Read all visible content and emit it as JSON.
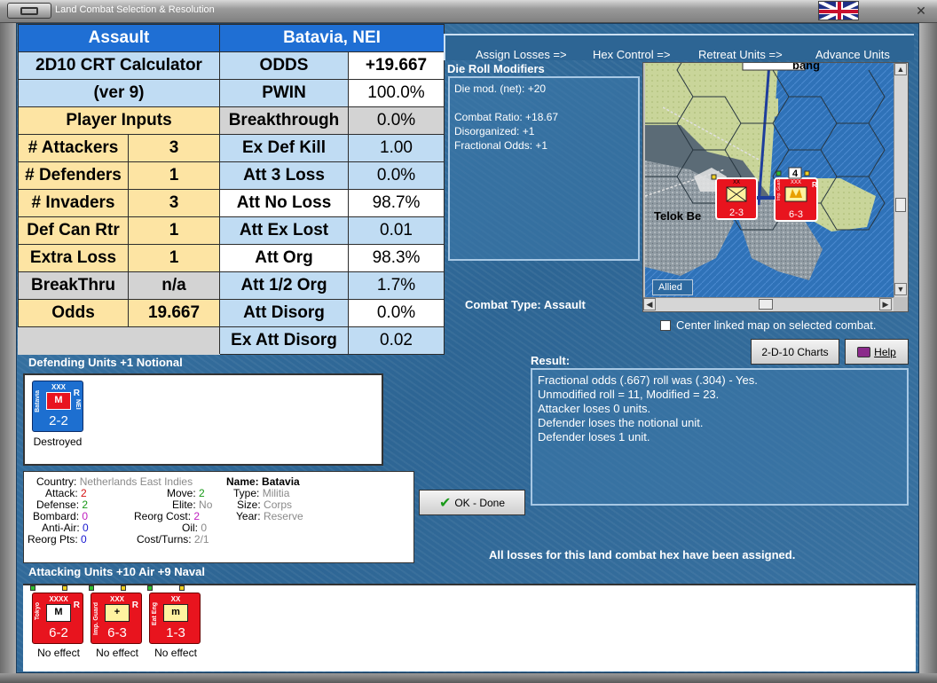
{
  "window": {
    "title": "Land Combat Selection & Resolution"
  },
  "crt": {
    "header_left": "Assault",
    "header_right": "Batavia, NEI",
    "calc_title": "2D10 CRT Calculator",
    "calc_version": "(ver 9)",
    "player_inputs_label": "Player Inputs",
    "inputs": [
      {
        "label": "# Attackers",
        "value": "3"
      },
      {
        "label": "# Defenders",
        "value": "1"
      },
      {
        "label": "# Invaders",
        "value": "3"
      },
      {
        "label": "Def Can Rtr",
        "value": "1"
      },
      {
        "label": "Extra Loss",
        "value": "1"
      },
      {
        "label": "BreakThru",
        "value": "n/a"
      },
      {
        "label": "Odds",
        "value": "19.667"
      }
    ],
    "results": [
      {
        "label": "ODDS",
        "value": "+19.667"
      },
      {
        "label": "PWIN",
        "value": "100.0%"
      },
      {
        "label": "Breakthrough",
        "value": "0.0%"
      },
      {
        "label": "Ex Def Kill",
        "value": "1.00"
      },
      {
        "label": "Att 3 Loss",
        "value": "0.0%"
      },
      {
        "label": "Att No Loss",
        "value": "98.7%"
      },
      {
        "label": "Att Ex Lost",
        "value": "0.01"
      },
      {
        "label": "Att Org",
        "value": "98.3%"
      },
      {
        "label": "Att 1/2 Org",
        "value": "1.7%"
      },
      {
        "label": "Att Disorg",
        "value": "0.0%"
      },
      {
        "label": "Ex Att Disorg",
        "value": "0.02"
      }
    ]
  },
  "phases": [
    "Assign Losses =>",
    "Hex Control =>",
    "Retreat Units =>",
    "Advance Units"
  ],
  "die_roll": {
    "title": "Die Roll Modifiers",
    "lines": [
      "Die mod. (net): +20",
      "",
      "Combat Ratio: +18.67",
      "Disorganized: +1",
      "Fractional Odds: +1"
    ]
  },
  "map": {
    "label_town": "Telok Be",
    "label_top": "bang",
    "allied_tab": "Allied",
    "stack_count": "4"
  },
  "combat_type": {
    "label": "Combat Type:",
    "value": "Assault"
  },
  "center_map": {
    "label": "Center linked map on selected combat."
  },
  "buttons": {
    "charts": "2-D-10 Charts",
    "help": "Help",
    "ok": "OK - Done"
  },
  "result": {
    "title": "Result:",
    "lines": [
      "Fractional odds (.667) roll was (.304)  - Yes.",
      "Unmodified roll = 11, Modified = 23.",
      "Attacker loses 0 units.",
      "Defender loses the notional unit.",
      "Defender loses 1 unit."
    ]
  },
  "defending": {
    "title": "Defending Units +1 Notional",
    "unit": {
      "side": "Batavia",
      "nation": "NEI",
      "size": "XXX",
      "strength": "2-2",
      "symbol": "M",
      "tag": "R",
      "caption": "Destroyed"
    }
  },
  "details": {
    "country_label": "Country:",
    "country": "Netherlands East Indies",
    "attack_label": "Attack:",
    "attack": "2",
    "defense_label": "Defense:",
    "defense": "2",
    "bombard_label": "Bombard:",
    "bombard": "0",
    "antiair_label": "Anti-Air:",
    "antiair": "0",
    "reorgpts_label": "Reorg Pts:",
    "reorgpts": "0",
    "move_label": "Move:",
    "move": "2",
    "elite_label": "Elite:",
    "elite": "No",
    "reorgcost_label": "Reorg Cost:",
    "reorgcost": "2",
    "oil_label": "Oil:",
    "oil": "0",
    "costturns_label": "Cost/Turns:",
    "costturns": "2/1",
    "name_label": "Name:",
    "name": "Batavia",
    "type_label": "Type:",
    "type": "Militia",
    "size_label": "Size:",
    "size": "Corps",
    "year_label": "Year:",
    "year": "Reserve"
  },
  "all_losses": "All losses for this land combat hex have been assigned.",
  "attacking": {
    "title": "Attacking Units +10 Air +9 Naval",
    "units": [
      {
        "side": "Tokyo",
        "size": "XXXX",
        "strength": "6-2",
        "symbol": "M",
        "tag": "R",
        "caption": "No effect"
      },
      {
        "side": "Imp. Guard",
        "size": "XXX",
        "strength": "6-3",
        "symbol": "+",
        "tag": "R",
        "caption": "No effect"
      },
      {
        "side": "Eat Eng",
        "size": "XX",
        "strength": "1-3",
        "symbol": "m",
        "tag": "",
        "caption": "No effect"
      }
    ]
  },
  "map_units": [
    {
      "size": "XX",
      "strength": "2-3"
    },
    {
      "side": "Imp. Guard",
      "size": "XXX",
      "strength": "6-3",
      "tag": "R"
    }
  ]
}
